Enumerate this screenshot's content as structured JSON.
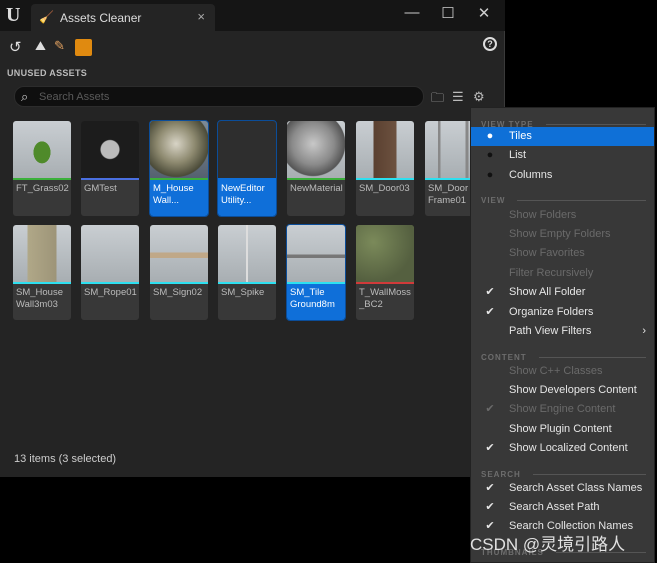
{
  "window": {
    "tab_title": "Assets Cleaner",
    "minimize": "—",
    "maximize": "☐",
    "close": "✕",
    "tab_close": "×"
  },
  "section_title": "UNUSED ASSETS",
  "search": {
    "placeholder": "Search Assets",
    "value": ""
  },
  "tiles": [
    {
      "label": "FT_Grass02",
      "bar": "#3bb03b",
      "selected": false,
      "thumb": "grass"
    },
    {
      "label": "GMTest",
      "bar": "#4a6fe0",
      "selected": false,
      "thumb": "blueprint"
    },
    {
      "label": "M_House\nWall...",
      "bar": "#3bb03b",
      "selected": true,
      "thumb": "sphere-wall"
    },
    {
      "label": "NewEditor\nUtility...",
      "bar": "#0f6fd9",
      "selected": true,
      "thumb": "widget"
    },
    {
      "label": "NewMaterial",
      "bar": "#3bb03b",
      "selected": false,
      "thumb": "sphere"
    },
    {
      "label": "SM_Door03",
      "bar": "#2de0f0",
      "selected": false,
      "thumb": "door"
    },
    {
      "label": "SM_Door\nFrame01",
      "bar": "#2de0f0",
      "selected": false,
      "thumb": "frame"
    },
    {
      "label": "SM_House\nWall3m03",
      "bar": "#2de0f0",
      "selected": false,
      "thumb": "wall"
    },
    {
      "label": "SM_Rope01",
      "bar": "#2de0f0",
      "selected": false,
      "thumb": "rope"
    },
    {
      "label": "SM_Sign02",
      "bar": "#2de0f0",
      "selected": false,
      "thumb": "sign"
    },
    {
      "label": "SM_Spike",
      "bar": "#2de0f0",
      "selected": false,
      "thumb": "spike"
    },
    {
      "label": "SM_Tile\nGround8m",
      "bar": "#2de0f0",
      "selected": true,
      "thumb": "tile"
    },
    {
      "label": "T_WallMoss\n_BC2",
      "bar": "#d03a3a",
      "selected": false,
      "thumb": "moss"
    }
  ],
  "status": "13 items (3 selected)",
  "menu": {
    "headers": [
      "VIEW TYPE",
      "VIEW",
      "CONTENT",
      "SEARCH",
      "THUMBNAILS"
    ],
    "items": [
      {
        "label": "Tiles",
        "mark": "●",
        "state": "on"
      },
      {
        "label": "List",
        "mark": "●",
        "state": "radio"
      },
      {
        "label": "Columns",
        "mark": "●",
        "state": "radio"
      },
      {
        "label": "Show Folders",
        "mark": "",
        "state": "dis"
      },
      {
        "label": "Show Empty Folders",
        "mark": "",
        "state": "dis"
      },
      {
        "label": "Show Favorites",
        "mark": "",
        "state": "dis"
      },
      {
        "label": "Filter Recursively",
        "mark": "",
        "state": "dis"
      },
      {
        "label": "Show All Folder",
        "mark": "✔",
        "state": "en"
      },
      {
        "label": "Organize Folders",
        "mark": "✔",
        "state": "en"
      },
      {
        "label": "Path View Filters",
        "mark": "",
        "state": "en",
        "submenu": "›"
      },
      {
        "label": "Show C++ Classes",
        "mark": "",
        "state": "dis"
      },
      {
        "label": "Show Developers Content",
        "mark": "",
        "state": "en"
      },
      {
        "label": "Show Engine Content",
        "mark": "✔",
        "state": "dis"
      },
      {
        "label": "Show Plugin Content",
        "mark": "",
        "state": "en"
      },
      {
        "label": "Show Localized Content",
        "mark": "✔",
        "state": "en"
      },
      {
        "label": "Search Asset Class Names",
        "mark": "✔",
        "state": "en"
      },
      {
        "label": "Search Asset Path",
        "mark": "✔",
        "state": "en"
      },
      {
        "label": "Search Collection Names",
        "mark": "✔",
        "state": "en"
      }
    ]
  },
  "watermark": "CSDN @灵境引路人"
}
